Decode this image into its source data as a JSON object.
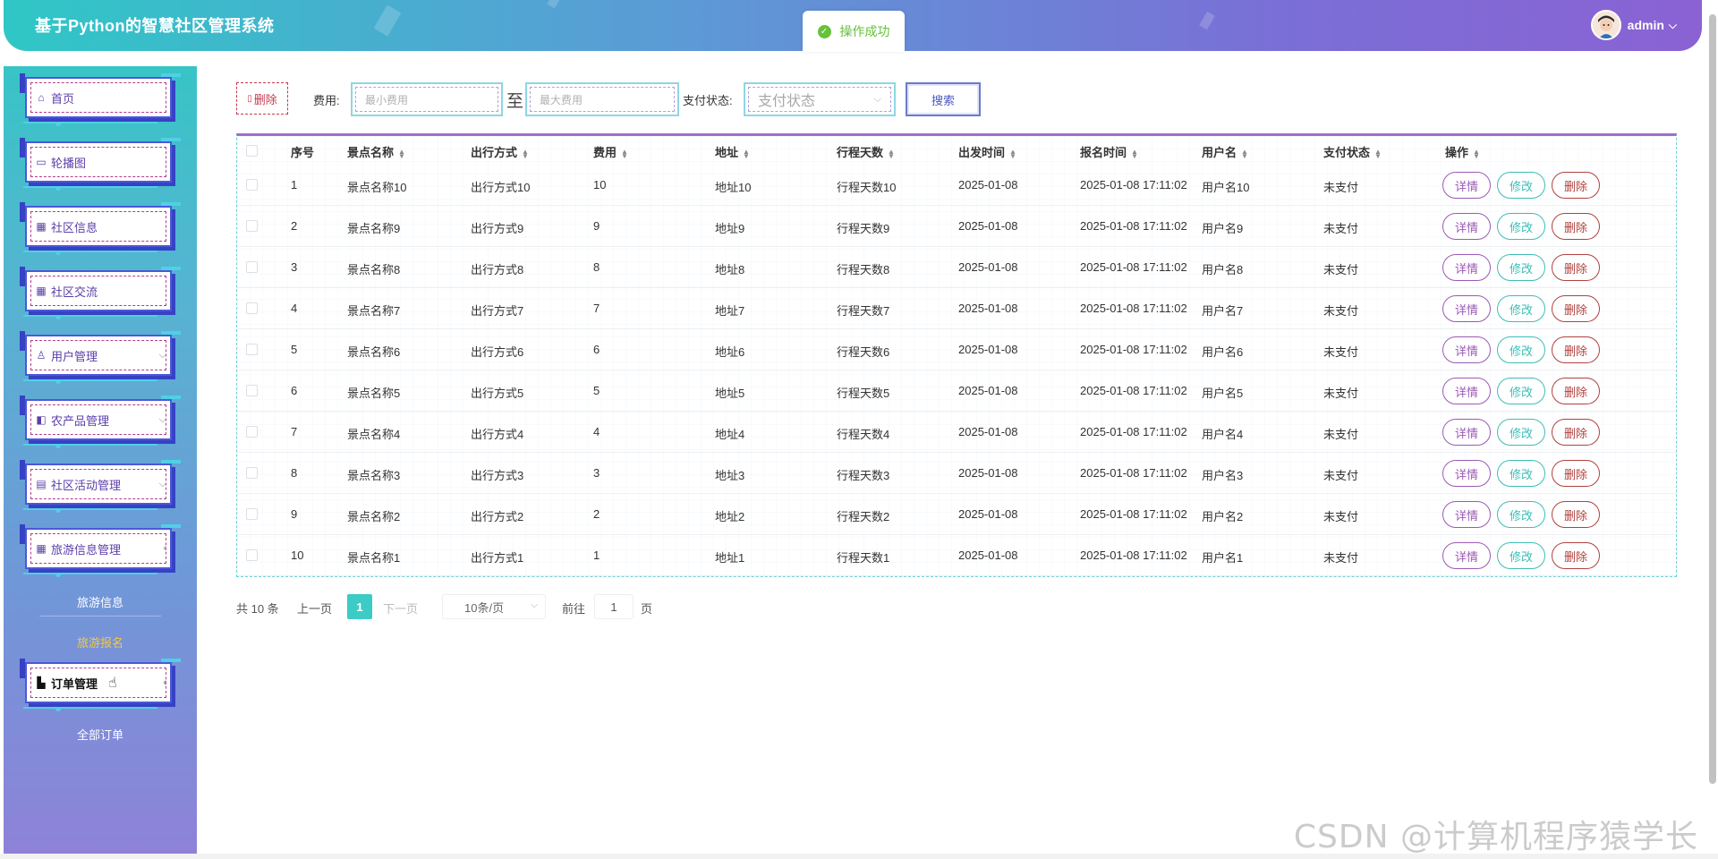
{
  "header": {
    "title": "基于Python的智慧社区管理系统",
    "username": "admin",
    "user_chevron": "⌵"
  },
  "toast": {
    "message": "操作成功",
    "icon": "check-circle-icon"
  },
  "sidebar": {
    "items": [
      {
        "label": "首页",
        "icon": "⌂",
        "chevron": ""
      },
      {
        "label": "轮播图",
        "icon": "▭",
        "chevron": ""
      },
      {
        "label": "社区信息",
        "icon": "▦",
        "chevron": ""
      },
      {
        "label": "社区交流",
        "icon": "▦",
        "chevron": ""
      },
      {
        "label": "用户管理",
        "icon": "♙",
        "chevron": "⌵"
      },
      {
        "label": "农产品管理",
        "icon": "◧",
        "chevron": "⌵"
      },
      {
        "label": "社区活动管理",
        "icon": "▤",
        "chevron": "⌵"
      },
      {
        "label": "旅游信息管理",
        "icon": "▦",
        "chevron": "‹"
      },
      {
        "label": "订单管理",
        "icon": "▙",
        "chevron": "‹"
      }
    ],
    "subitems": {
      "travel_info": "旅游信息",
      "travel_signup": "旅游报名",
      "all_orders": "全部订单"
    }
  },
  "toolbar": {
    "delete_label": "删除",
    "fee_label": "费用:",
    "min_fee_placeholder": "最小费用",
    "to_label": "至",
    "max_fee_placeholder": "最大费用",
    "pay_status_label": "支付状态:",
    "pay_status_placeholder": "支付状态",
    "search_label": "搜索"
  },
  "table": {
    "columns": [
      "序号",
      "景点名称",
      "出行方式",
      "费用",
      "地址",
      "行程天数",
      "出发时间",
      "报名时间",
      "用户名",
      "支付状态",
      "操作"
    ],
    "rows": [
      [
        "1",
        "景点名称10",
        "出行方式10",
        "10",
        "地址10",
        "行程天数10",
        "2025-01-08",
        "2025-01-08 17:11:02",
        "用户名10",
        "未支付"
      ],
      [
        "2",
        "景点名称9",
        "出行方式9",
        "9",
        "地址9",
        "行程天数9",
        "2025-01-08",
        "2025-01-08 17:11:02",
        "用户名9",
        "未支付"
      ],
      [
        "3",
        "景点名称8",
        "出行方式8",
        "8",
        "地址8",
        "行程天数8",
        "2025-01-08",
        "2025-01-08 17:11:02",
        "用户名8",
        "未支付"
      ],
      [
        "4",
        "景点名称7",
        "出行方式7",
        "7",
        "地址7",
        "行程天数7",
        "2025-01-08",
        "2025-01-08 17:11:02",
        "用户名7",
        "未支付"
      ],
      [
        "5",
        "景点名称6",
        "出行方式6",
        "6",
        "地址6",
        "行程天数6",
        "2025-01-08",
        "2025-01-08 17:11:02",
        "用户名6",
        "未支付"
      ],
      [
        "6",
        "景点名称5",
        "出行方式5",
        "5",
        "地址5",
        "行程天数5",
        "2025-01-08",
        "2025-01-08 17:11:02",
        "用户名5",
        "未支付"
      ],
      [
        "7",
        "景点名称4",
        "出行方式4",
        "4",
        "地址4",
        "行程天数4",
        "2025-01-08",
        "2025-01-08 17:11:02",
        "用户名4",
        "未支付"
      ],
      [
        "8",
        "景点名称3",
        "出行方式3",
        "3",
        "地址3",
        "行程天数3",
        "2025-01-08",
        "2025-01-08 17:11:02",
        "用户名3",
        "未支付"
      ],
      [
        "9",
        "景点名称2",
        "出行方式2",
        "2",
        "地址2",
        "行程天数2",
        "2025-01-08",
        "2025-01-08 17:11:02",
        "用户名2",
        "未支付"
      ],
      [
        "10",
        "景点名称1",
        "出行方式1",
        "1",
        "地址1",
        "行程天数1",
        "2025-01-08",
        "2025-01-08 17:11:02",
        "用户名1",
        "未支付"
      ]
    ],
    "actions": {
      "detail": "详情",
      "edit": "修改",
      "delete": "删除"
    }
  },
  "pagination": {
    "total": "共 10 条",
    "prev": "上一页",
    "current": "1",
    "next": "下一页",
    "page_size": "10条/页",
    "goto_label": "前往",
    "goto_value": "1",
    "page_suffix": "页"
  },
  "watermark": "CSDN @计算机程序猿学长",
  "colors": {
    "header_start": "#2fc7c6",
    "header_end": "#8a62d3",
    "accent_teal": "#3dcbc6",
    "detail_purple": "#9b59b6",
    "edit_teal": "#3dbdb5",
    "delete_red": "#b0413e",
    "toast_green": "#67c23a"
  }
}
